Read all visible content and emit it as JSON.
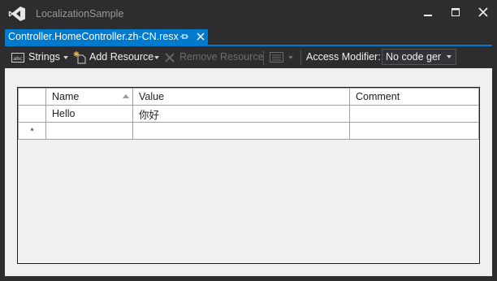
{
  "window": {
    "title": "LocalizationSample"
  },
  "tab": {
    "label": "Controller.HomeController.zh-CN.resx"
  },
  "toolbar": {
    "strings_label": "Strings",
    "add_resource_label": "Add Resource",
    "remove_resource_label": "Remove Resource",
    "access_modifier_label": "Access Modifier:",
    "access_modifier_value": "No code generation"
  },
  "grid": {
    "columns": [
      "Name",
      "Value",
      "Comment"
    ],
    "rows": [
      {
        "name": "Hello",
        "value": "你好",
        "comment": ""
      }
    ],
    "new_row_marker": "*"
  },
  "colors": {
    "accent": "#007acc",
    "chrome": "#2d2d30",
    "vs_purple": "#68217a"
  }
}
